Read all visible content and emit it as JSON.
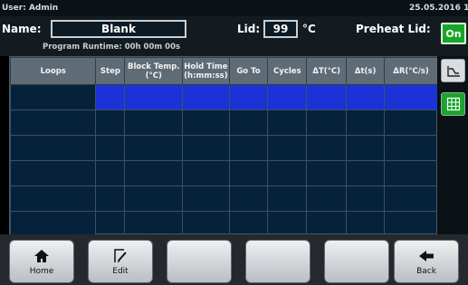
{
  "topbar": {
    "user": "User: Admin",
    "datetime": "25.05.2016 13:2"
  },
  "header": {
    "name_label": "Name:",
    "name_value": "Blank",
    "lid_label": "Lid:",
    "lid_value": "99",
    "lid_unit": "°C",
    "preheat_label": "Preheat Lid:",
    "preheat_state": "On",
    "runtime": "Program Runtime:  00h 00m 00s"
  },
  "table": {
    "columns": [
      "Loops",
      "Step",
      "Block Temp. (°C)",
      "Hold Time (h:mm:ss)",
      "Go To",
      "Cycles",
      "ΔT(°C)",
      "Δt(s)",
      "ΔR(°C/s)"
    ],
    "rows": 6,
    "selected_row": 0
  },
  "sidebar": {
    "icons": [
      "temperature-profile-icon",
      "grid-view-icon"
    ],
    "accent": "#1aa52b"
  },
  "bottom": {
    "buttons": [
      {
        "label": "Home",
        "icon": "home-icon"
      },
      {
        "label": "Edit",
        "icon": "edit-icon"
      },
      {
        "label": "",
        "icon": ""
      },
      {
        "label": "",
        "icon": ""
      },
      {
        "label": "",
        "icon": ""
      },
      {
        "label": "Back",
        "icon": "back-arrow-icon"
      }
    ]
  },
  "colors": {
    "selected_row": "#1c32d6",
    "on_button": "#1aa52b",
    "table_bg": "#05223a"
  }
}
